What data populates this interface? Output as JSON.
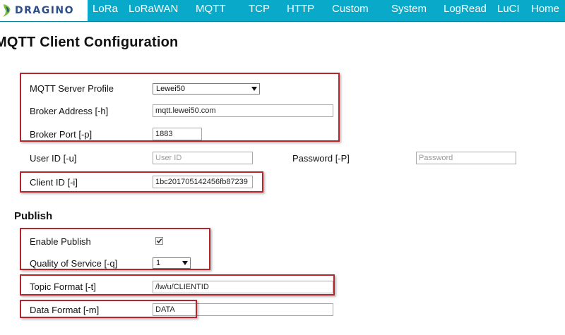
{
  "brand": {
    "logo_text": "DRAGINO"
  },
  "nav": {
    "lora": "LoRa",
    "lorawan": "LoRaWAN",
    "mqtt": "MQTT",
    "tcp": "TCP",
    "http": "HTTP",
    "custom": "Custom",
    "system": "System",
    "logread": "LogRead",
    "luci": "LuCI",
    "home": "Home"
  },
  "page": {
    "title": "MQTT Client Configuration"
  },
  "server": {
    "profile_label": "MQTT Server Profile",
    "profile_value": "Lewei50",
    "broker_address_label": "Broker Address [-h]",
    "broker_address_value": "mqtt.lewei50.com",
    "broker_port_label": "Broker Port [-p]",
    "broker_port_value": "1883",
    "user_id_label": "User ID [-u]",
    "user_id_placeholder": "User ID",
    "password_label": "Password [-P]",
    "password_placeholder": "Password",
    "client_id_label": "Client ID [-i]",
    "client_id_value": "1bc201705142456fb87239"
  },
  "publish": {
    "section_title": "Publish",
    "enable_label": "Enable Publish",
    "enable_checked": true,
    "qos_label": "Quality of Service [-q]",
    "qos_value": "1",
    "topic_format_label": "Topic Format [-t]",
    "topic_format_value": "/lw/u/CLIENTID",
    "data_format_label": "Data Format [-m]",
    "data_format_value": "DATA"
  },
  "colors": {
    "nav_background": "#08a9c9",
    "highlight_border": "#b4252d",
    "logo_text": "#2f4e8c"
  }
}
